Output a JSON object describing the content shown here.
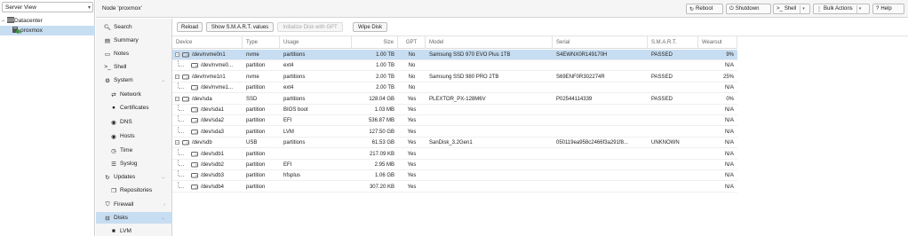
{
  "tree": {
    "view_label": "Server View",
    "datacenter": "Datacenter",
    "node": "proxmox"
  },
  "header": {
    "title": "Node 'proxmox'",
    "reboot": "Reboot",
    "shutdown": "Shutdown",
    "shell": "Shell",
    "bulk_actions": "Bulk Actions",
    "help": "Help"
  },
  "nav": {
    "search": "Search",
    "summary": "Summary",
    "notes": "Notes",
    "shell": "Shell",
    "system": "System",
    "network": "Network",
    "certificates": "Certificates",
    "dns": "DNS",
    "hosts": "Hosts",
    "time": "Time",
    "syslog": "Syslog",
    "updates": "Updates",
    "repositories": "Repositories",
    "firewall": "Firewall",
    "disks": "Disks",
    "lvm": "LVM"
  },
  "toolbar": {
    "reload": "Reload",
    "smart": "Show S.M.A.R.T. values",
    "init_gpt": "Initialize Disk with GPT",
    "wipe": "Wipe Disk"
  },
  "columns": [
    "Device",
    "Type",
    "Usage",
    "Size",
    "GPT",
    "Model",
    "Serial",
    "S.M.A.R.T.",
    "Wearout"
  ],
  "rows": [
    {
      "device": "/dev/nvme0n1",
      "type": "nvme",
      "usage": "partitions",
      "size": "1.00 TB",
      "gpt": "No",
      "model": "Samsung SSD 970 EVO Plus 1TB",
      "serial": "S4EWNX0R149170H",
      "smart": "PASSED",
      "wearout": "9%",
      "level": 0,
      "selected": true
    },
    {
      "device": "/dev/nvme0...",
      "type": "partition",
      "usage": "ext4",
      "size": "1.00 TB",
      "gpt": "No",
      "model": "",
      "serial": "",
      "smart": "",
      "wearout": "N/A",
      "level": 1
    },
    {
      "device": "/dev/nvme1n1",
      "type": "nvme",
      "usage": "partitions",
      "size": "2.00 TB",
      "gpt": "No",
      "model": "Samsung SSD 980 PRO 2TB",
      "serial": "S69ENF0R302274R",
      "smart": "PASSED",
      "wearout": "25%",
      "level": 0
    },
    {
      "device": "/dev/nvme1...",
      "type": "partition",
      "usage": "ext4",
      "size": "2.00 TB",
      "gpt": "No",
      "model": "",
      "serial": "",
      "smart": "",
      "wearout": "N/A",
      "level": 1
    },
    {
      "device": "/dev/sda",
      "type": "SSD",
      "usage": "partitions",
      "size": "128.04 GB",
      "gpt": "Yes",
      "model": "PLEXTOR_PX-128M6V",
      "serial": "P02544114339",
      "smart": "PASSED",
      "wearout": "0%",
      "level": 0
    },
    {
      "device": "/dev/sda1",
      "type": "partition",
      "usage": "BIOS boot",
      "size": "1.03 MB",
      "gpt": "Yes",
      "model": "",
      "serial": "",
      "smart": "",
      "wearout": "N/A",
      "level": 1
    },
    {
      "device": "/dev/sda2",
      "type": "partition",
      "usage": "EFI",
      "size": "536.87 MB",
      "gpt": "Yes",
      "model": "",
      "serial": "",
      "smart": "",
      "wearout": "N/A",
      "level": 1
    },
    {
      "device": "/dev/sda3",
      "type": "partition",
      "usage": "LVM",
      "size": "127.50 GB",
      "gpt": "Yes",
      "model": "",
      "serial": "",
      "smart": "",
      "wearout": "N/A",
      "level": 1
    },
    {
      "device": "/dev/sdb",
      "type": "USB",
      "usage": "partitions",
      "size": "61.53 GB",
      "gpt": "Yes",
      "model": "SanDisk_3.2Gen1",
      "serial": "050119ea958c2466f3a291f8...",
      "smart": "UNKNOWN",
      "wearout": "N/A",
      "level": 0
    },
    {
      "device": "/dev/sdb1",
      "type": "partition",
      "usage": "",
      "size": "217.09 KB",
      "gpt": "Yes",
      "model": "",
      "serial": "",
      "smart": "",
      "wearout": "N/A",
      "level": 1
    },
    {
      "device": "/dev/sdb2",
      "type": "partition",
      "usage": "EFI",
      "size": "2.95 MB",
      "gpt": "Yes",
      "model": "",
      "serial": "",
      "smart": "",
      "wearout": "N/A",
      "level": 1
    },
    {
      "device": "/dev/sdb3",
      "type": "partition",
      "usage": "hfsplus",
      "size": "1.06 GB",
      "gpt": "Yes",
      "model": "",
      "serial": "",
      "smart": "",
      "wearout": "N/A",
      "level": 1
    },
    {
      "device": "/dev/sdb4",
      "type": "partition",
      "usage": "",
      "size": "307.20 KB",
      "gpt": "Yes",
      "model": "",
      "serial": "",
      "smart": "",
      "wearout": "N/A",
      "level": 1
    }
  ],
  "colors": {
    "selection": "#c7ddf1",
    "panel": "#f5f5f5",
    "node_online": "#3c9a3c"
  }
}
